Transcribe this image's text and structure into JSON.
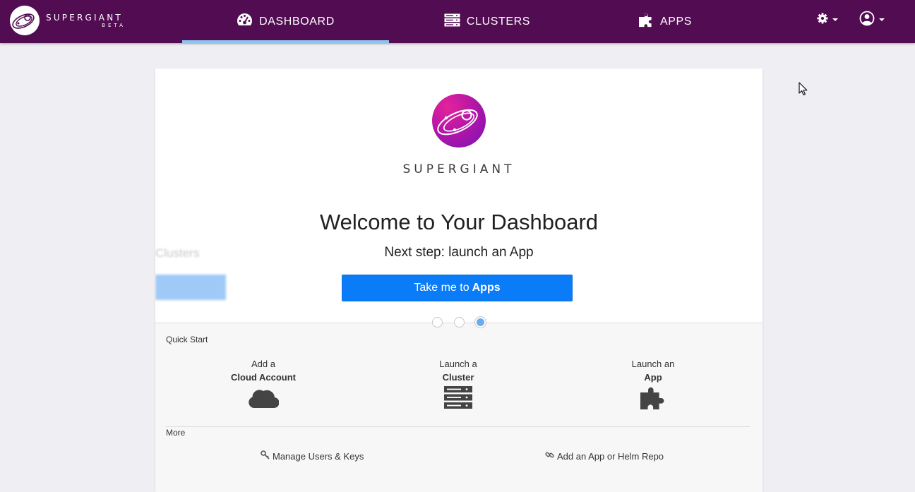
{
  "navbar": {
    "brand": {
      "name": "SUPERGIANT",
      "tag": "BETA"
    },
    "tabs": [
      {
        "label": "DASHBOARD",
        "icon": "dashboard-gauge-icon",
        "active": true
      },
      {
        "label": "CLUSTERS",
        "icon": "server-stack-icon",
        "active": false
      },
      {
        "label": "APPS",
        "icon": "puzzle-piece-icon",
        "active": false
      }
    ],
    "settings_icon": "gear-icon",
    "user_icon": "user-circle-icon",
    "bg_color": "#520c52",
    "active_underline_color": "#8fc3ee"
  },
  "hero": {
    "brand": "SUPERGIANT",
    "title": "Welcome to Your Dashboard",
    "subtitle": "Next step: launch an App",
    "button_prefix": "Take me to",
    "button_strong": "Apps",
    "ghost_text": "Clusters",
    "slides_total": 3,
    "active_slide": 3,
    "button_color": "#0b7cf7"
  },
  "quick_start": {
    "label": "Quick Start",
    "items": [
      {
        "line1": "Add a",
        "line2": "Cloud Account",
        "icon": "cloud-icon"
      },
      {
        "line1": "Launch a",
        "line2": "Cluster",
        "icon": "server-stack-icon"
      },
      {
        "line1": "Launch an",
        "line2": "App",
        "icon": "puzzle-piece-icon"
      }
    ]
  },
  "more": {
    "label": "More",
    "links": [
      {
        "label": "Manage Users & Keys",
        "icon": "key-icon"
      },
      {
        "label": "Add an App or Helm Repo",
        "icon": "link-icon"
      }
    ]
  }
}
